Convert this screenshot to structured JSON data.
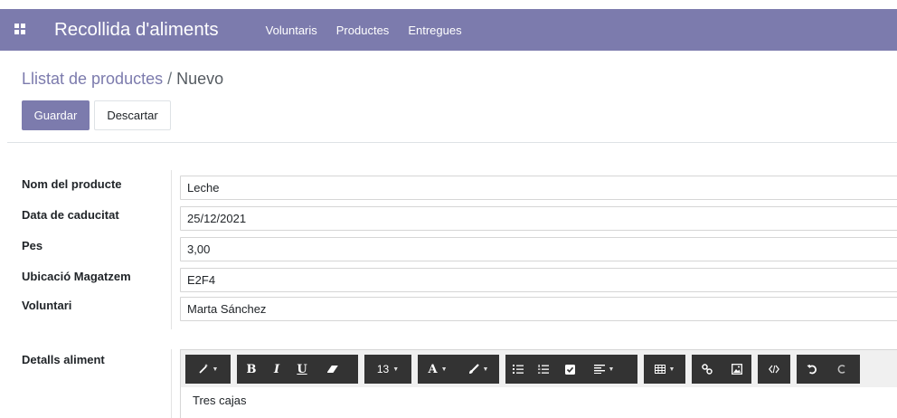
{
  "navbar": {
    "brand": "Recollida d'aliments",
    "menu": [
      "Voluntaris",
      "Productes",
      "Entregues"
    ]
  },
  "breadcrumb": {
    "parent": "Llistat de productes",
    "separator": " / ",
    "current": "Nuevo"
  },
  "actions": {
    "save_label": "Guardar",
    "discard_label": "Descartar"
  },
  "form": {
    "fields": [
      {
        "label": "Nom del producte",
        "value": "Leche"
      },
      {
        "label": "Data de caducitat",
        "value": "25/12/2021"
      },
      {
        "label": "Pes",
        "value": "3,00"
      },
      {
        "label": "Ubicació Magatzem",
        "value": "E2F4"
      },
      {
        "label": "Voluntari",
        "value": "Marta Sánchez"
      }
    ],
    "details_label": "Detalls aliment",
    "details_content": "Tres cajas"
  },
  "toolbar": {
    "font_size": "13",
    "bold": "B",
    "italic": "I",
    "underline": "U",
    "font_color": "A"
  },
  "icons": {
    "apps": "apps-grid-icon",
    "magic": "magic-wand-icon",
    "eraser": "eraser-icon",
    "brush": "brush-icon",
    "ul": "unordered-list-icon",
    "ol": "ordered-list-icon",
    "checklist": "checklist-icon",
    "align": "align-icon",
    "table": "table-icon",
    "link": "link-icon",
    "image": "image-icon",
    "code": "code-view-icon",
    "undo": "undo-icon",
    "redo": "redo-icon"
  },
  "colors": {
    "brand": "#7c7bad",
    "toolbar_bg": "#333333",
    "border": "#d6d6d6"
  }
}
